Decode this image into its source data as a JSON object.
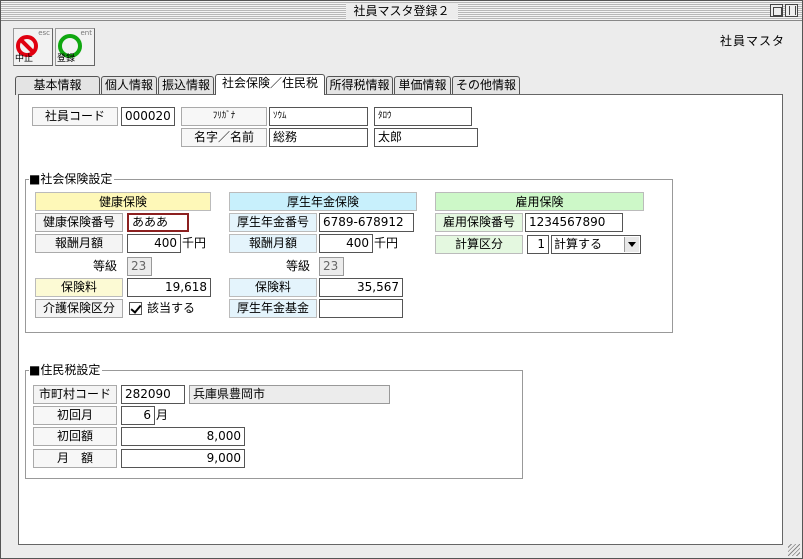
{
  "window": {
    "title": "社員マスタ登録２"
  },
  "toolbar": {
    "stop": {
      "label": "中止",
      "hint": "esc"
    },
    "save": {
      "label": "登録",
      "hint": "ent"
    }
  },
  "app_label": "社員マスタ",
  "tabs": [
    {
      "label": "基本情報"
    },
    {
      "label": "個人情報"
    },
    {
      "label": "振込情報"
    },
    {
      "label": "社会保険／住民税"
    },
    {
      "label": "所得税情報"
    },
    {
      "label": "単価情報"
    },
    {
      "label": "その他情報"
    }
  ],
  "employee": {
    "code_label": "社員コード",
    "code": "000020",
    "kana_label": "ﾌﾘｶﾞﾅ",
    "kana_last": "ｿｳﾑ",
    "kana_first": "ﾀﾛｳ",
    "name_label": "名字／名前",
    "last_name": "総務",
    "first_name": "太郎"
  },
  "social": {
    "title": "■社会保険設定",
    "health": {
      "header": "健康保険",
      "number_label": "健康保険番号",
      "number": "あああ",
      "salary_label": "報酬月額",
      "salary": "400",
      "salary_unit": "千円",
      "grade_label": "等級",
      "grade": "23",
      "premium_label": "保険料",
      "premium": "19,618",
      "care_label": "介護保険区分",
      "care_check_label": "該当する"
    },
    "pension": {
      "header": "厚生年金保険",
      "number_label": "厚生年金番号",
      "number": "6789-678912",
      "salary_label": "報酬月額",
      "salary": "400",
      "salary_unit": "千円",
      "grade_label": "等級",
      "grade": "23",
      "premium_label": "保険料",
      "premium": "35,567",
      "fund_label": "厚生年金基金",
      "fund": ""
    },
    "employment": {
      "header": "雇用保険",
      "number_label": "雇用保険番号",
      "number": "1234567890",
      "calc_label": "計算区分",
      "calc_code": "1",
      "calc_value": "計算する"
    }
  },
  "resident": {
    "title": "■住民税設定",
    "city_label": "市町村コード",
    "city_code": "282090",
    "city_name": "兵庫県豊岡市",
    "first_month_label": "初回月",
    "first_month": "6",
    "first_month_unit": "月",
    "first_amount_label": "初回額",
    "first_amount": "8,000",
    "monthly_label": "月　額",
    "monthly": "9,000"
  }
}
